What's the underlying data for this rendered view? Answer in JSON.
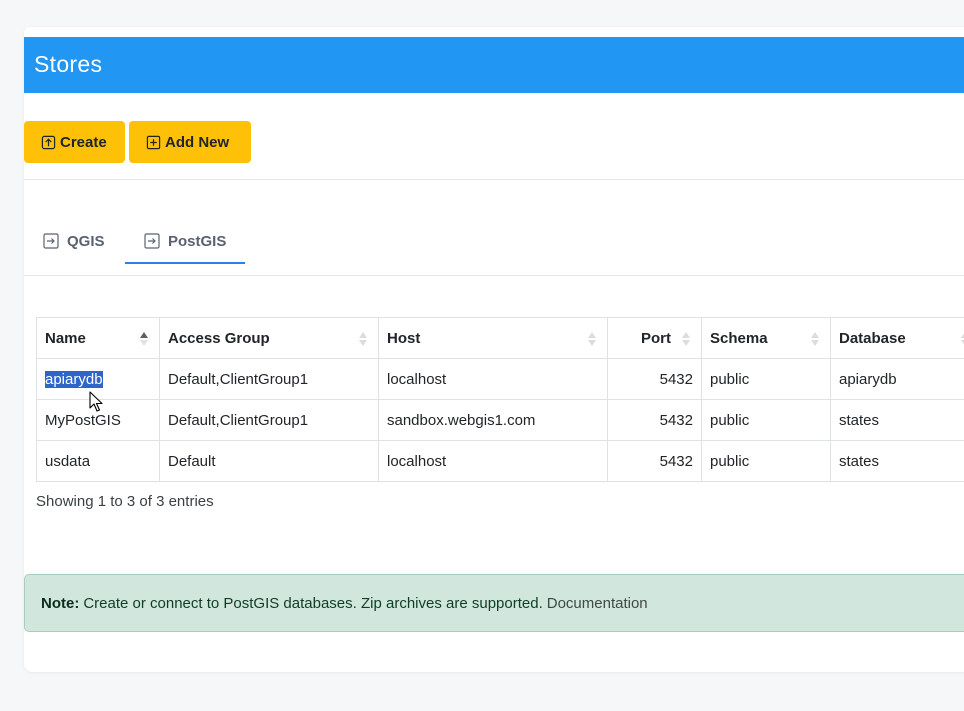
{
  "header": {
    "title": "Stores"
  },
  "toolbar": {
    "create_label": "Create",
    "add_new_label": "Add New"
  },
  "tabs": [
    {
      "label": "QGIS",
      "active": false
    },
    {
      "label": "PostGIS",
      "active": true
    }
  ],
  "table": {
    "columns": [
      "Name",
      "Access Group",
      "Host",
      "Port",
      "Schema",
      "Database"
    ],
    "sorted_column": "Name",
    "sort_direction": "asc",
    "rows": [
      {
        "name": "apiarydb",
        "access_group": "Default,ClientGroup1",
        "host": "localhost",
        "port": "5432",
        "schema": "public",
        "database": "apiarydb"
      },
      {
        "name": "MyPostGIS",
        "access_group": "Default,ClientGroup1",
        "host": "sandbox.webgis1.com",
        "port": "5432",
        "schema": "public",
        "database": "states"
      },
      {
        "name": "usdata",
        "access_group": "Default",
        "host": "localhost",
        "port": "5432",
        "schema": "public",
        "database": "states"
      }
    ],
    "info": "Showing 1 to 3 of 3 entries"
  },
  "note": {
    "label": "Note:",
    "text": "Create or connect to PostGIS databases. Zip archives are supported.",
    "link": "Documentation"
  },
  "colors": {
    "header_bg": "#2196f3",
    "button_bg": "#ffc107",
    "tab_active": "#2f7ee6",
    "note_bg": "#d1e7dd",
    "selection": "#2f64c8"
  },
  "icons": {
    "create": "upload-icon",
    "add_new": "plus-square-icon",
    "tab": "arrow-in-square-icon",
    "sort_asc": "sort-up-icon",
    "sort_both": "sort-both-icon"
  }
}
